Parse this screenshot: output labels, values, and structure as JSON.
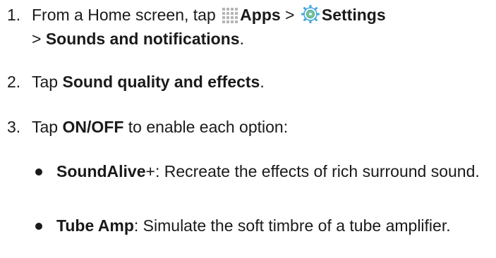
{
  "steps": [
    {
      "number": "1.",
      "parts": {
        "t1": "From a Home screen, tap",
        "apps_label": "Apps",
        "sep1": ">",
        "settings_label": "Settings",
        "sep2": ">",
        "sounds_label": "Sounds and notifications",
        "end": "."
      }
    },
    {
      "number": "2.",
      "parts": {
        "t1": "Tap",
        "bold": "Sound quality and effects",
        "end": "."
      }
    },
    {
      "number": "3.",
      "parts": {
        "t1": "Tap",
        "bold": "ON/OFF",
        "t2": "to enable each option:"
      }
    }
  ],
  "options": [
    {
      "name": "SoundAlive",
      "suffix": "+",
      "description": ": Recreate the effects of rich surround sound."
    },
    {
      "name": "Tube Amp",
      "suffix": "",
      "description": ": Simulate the soft timbre of a tube amplifier."
    }
  ],
  "icons": {
    "apps": "apps-grid-icon",
    "settings": "settings-gear-icon"
  },
  "colors": {
    "text": "#1a1a1a",
    "apps_icon": "#b5b5b5",
    "settings_icon_outer": "#4aa8d8",
    "settings_icon_inner": "#8fd14f"
  }
}
